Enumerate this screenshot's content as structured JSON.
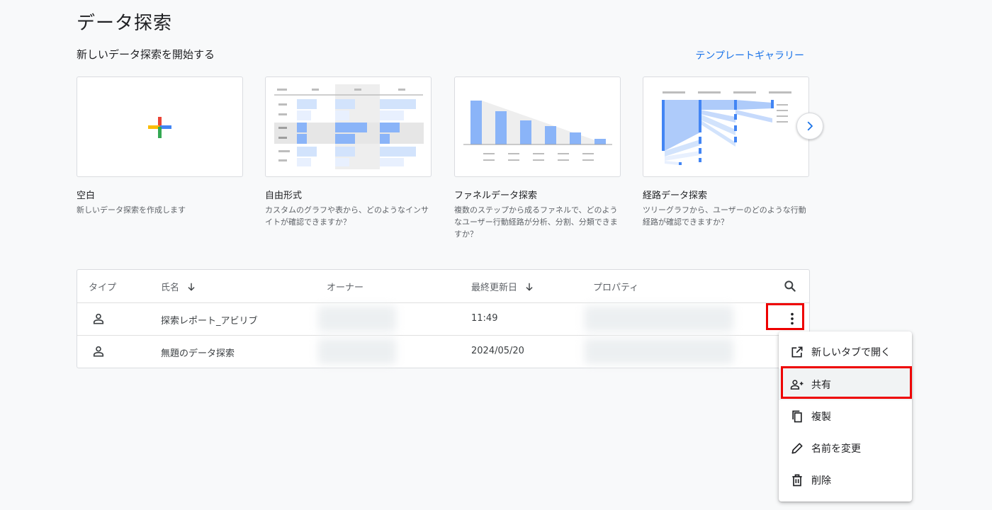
{
  "header": {
    "title": "データ探索",
    "section_title": "新しいデータ探索を開始する",
    "gallery_link": "テンプレートギャラリー"
  },
  "templates": [
    {
      "title": "空白",
      "description": "新しいデータ探索を作成します",
      "icon": "plus-icon"
    },
    {
      "title": "自由形式",
      "description": "カスタムのグラフや表から、どのようなインサイトが確認できますか？",
      "icon": "table-thumbnail"
    },
    {
      "title": "ファネルデータ探索",
      "description": "複数のステップから成るファネルで、どのようなユーザー行動経路が分析、分割、分類できますか？",
      "icon": "funnel-thumbnail"
    },
    {
      "title": "経路データ探索",
      "description": "ツリーグラフから、ユーザーのどのような行動経路が確認できますか？",
      "icon": "path-thumbnail"
    }
  ],
  "table": {
    "columns": {
      "type": "タイプ",
      "name": "氏名",
      "owner": "オーナー",
      "modified": "最終更新日",
      "property": "プロパティ"
    },
    "rows": [
      {
        "name": "探索レポート_アビリブ",
        "modified": "11:49",
        "type_icon": "person-icon"
      },
      {
        "name": "無題のデータ探索",
        "modified": "2024/05/20",
        "type_icon": "person-icon"
      }
    ]
  },
  "menu": {
    "items": [
      {
        "label": "新しいタブで開く",
        "icon": "open-in-new-icon"
      },
      {
        "label": "共有",
        "icon": "person-add-icon"
      },
      {
        "label": "複製",
        "icon": "copy-icon"
      },
      {
        "label": "名前を変更",
        "icon": "edit-icon"
      },
      {
        "label": "削除",
        "icon": "delete-icon"
      }
    ]
  },
  "colors": {
    "accent": "#1a73e8",
    "highlight": "#e00000",
    "bar": "#8ab4f8",
    "bar_light": "#d2e3fc"
  }
}
